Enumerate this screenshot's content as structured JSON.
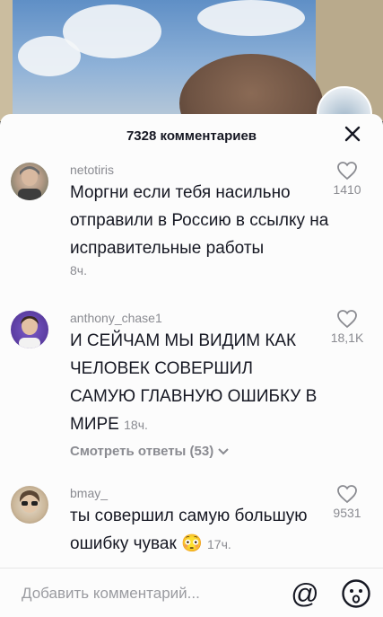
{
  "header": {
    "comment_count": "7328 комментариев"
  },
  "comments": [
    {
      "username": "netotiris",
      "text": "Моргни если тебя насильно отправили в Россию в ссылку на исправительные работы",
      "time": "8ч.",
      "likes": "1410"
    },
    {
      "username": "anthony_chase1",
      "text": "И СЕЙЧАМ МЫ ВИДИМ КАК ЧЕЛОВЕК СОВЕРШИЛ САМУЮ ГЛАВНУЮ ОШИБКУ В МИРЕ",
      "time": "18ч.",
      "likes": "18,1K",
      "replies_label": "Смотреть ответы (53)"
    },
    {
      "username": "bmay_",
      "text": "ты совершил самую большую ошибку чувак",
      "emoji": "😳",
      "time": "17ч.",
      "likes": "9531"
    }
  ],
  "input": {
    "placeholder": "Добавить комментарий..."
  },
  "icons": {
    "close": "close-icon",
    "like": "heart-outline-icon",
    "mention": "at-icon",
    "emoji": "emoji-icon"
  },
  "colors": {
    "text": "#161823",
    "muted": "#8a8b91",
    "sheet": "#fcfcfc"
  }
}
